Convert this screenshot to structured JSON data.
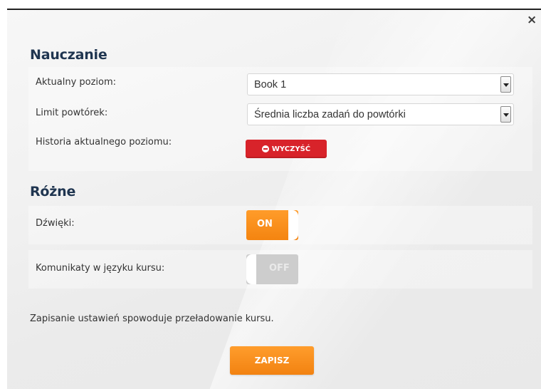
{
  "dialog": {
    "close_icon": "×"
  },
  "teaching": {
    "title": "Nauczanie",
    "current_level": {
      "label": "Aktualny poziom:",
      "value": "Book 1"
    },
    "review_limit": {
      "label": "Limit powtórek:",
      "value": "Średnia liczba zadań do powtórki"
    },
    "level_history": {
      "label": "Historia aktualnego poziomu:",
      "button_label": "WYCZYŚĆ"
    }
  },
  "misc": {
    "title": "Różne",
    "sounds": {
      "label": "Dźwięki:",
      "state": "ON",
      "on": true
    },
    "course_language_messages": {
      "label": "Komunikaty w języku kursu:",
      "state": "OFF",
      "on": false
    }
  },
  "footer": {
    "note": "Zapisanie ustawień spowoduje przeładowanie kursu.",
    "save_label": "ZAPISZ"
  },
  "colors": {
    "accent_orange": "#f48410",
    "danger_red": "#d8232a",
    "heading_blue": "#1f3550"
  }
}
